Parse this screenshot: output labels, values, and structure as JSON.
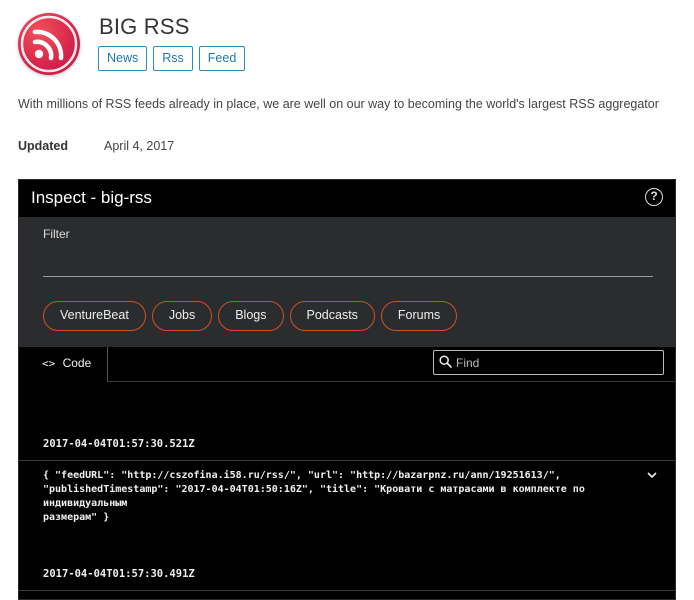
{
  "app": {
    "title": "BIG RSS",
    "tags": [
      "News",
      "Rss",
      "Feed"
    ],
    "description": "With millions of RSS feeds already in place, we are well on our way to becoming the world's largest RSS aggregator",
    "updated_label": "Updated",
    "updated_value": "April 4, 2017"
  },
  "panel": {
    "title": "Inspect - big-rss",
    "help_glyph": "?",
    "filter_label": "Filter",
    "filter_value": "",
    "chips": [
      "VentureBeat",
      "Jobs",
      "Blogs",
      "Podcasts",
      "Forums"
    ],
    "tab_icon": "<>",
    "tab_label": "Code",
    "find_placeholder": "Find"
  },
  "log": {
    "entries": [
      {
        "timestamp": "2017-04-04T01:57:30.521Z"
      },
      {
        "line1": "{ \"feedURL\": \"http://cszofina.i58.ru/rss/\", \"url\": \"http://bazarpnz.ru/ann/19251613/\",",
        "line2": "\"publishedTimestamp\": \"2017-04-04T01:50:16Z\", \"title\": \"Кровати с матрасами в комплекте по индивидуальным",
        "line3": "размерам\" }"
      },
      {
        "timestamp": "2017-04-04T01:57:30.491Z"
      }
    ]
  },
  "colors": {
    "brand": "#d6224a",
    "tag_border": "#2a8fbd",
    "chip_border": "#d0502a",
    "panel_bg": "#000000",
    "filter_bg": "#2b2c2e"
  },
  "icons": [
    "rss-logo-icon",
    "help-icon",
    "code-icon",
    "search-icon",
    "chevron-down-icon"
  ]
}
